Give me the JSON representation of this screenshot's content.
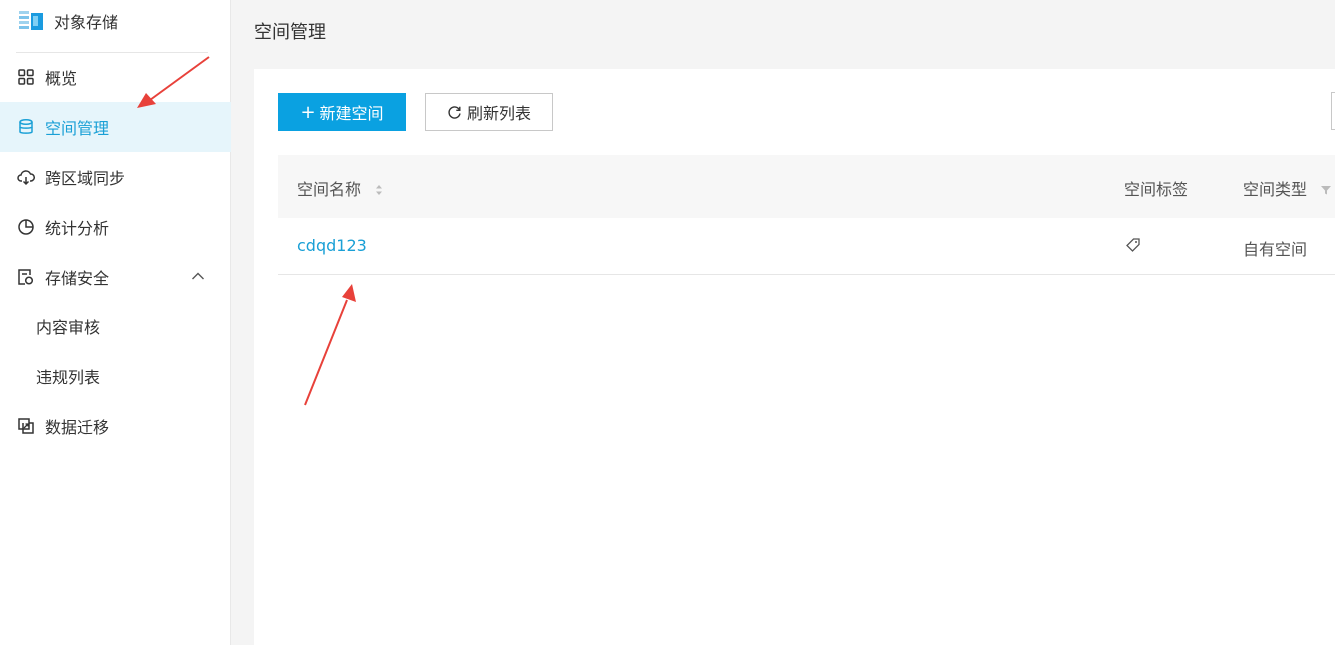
{
  "sidebar": {
    "brand_title": "对象存储",
    "items": [
      {
        "label": "概览",
        "icon": "grid-icon"
      },
      {
        "label": "空间管理",
        "icon": "database-icon",
        "active": true
      },
      {
        "label": "跨区域同步",
        "icon": "cloud-sync-icon"
      },
      {
        "label": "统计分析",
        "icon": "pie-chart-icon"
      },
      {
        "label": "存储安全",
        "icon": "shield-doc-icon",
        "expanded": true
      },
      {
        "label": "内容审核"
      },
      {
        "label": "违规列表"
      },
      {
        "label": "数据迁移",
        "icon": "migrate-icon"
      }
    ]
  },
  "header": {
    "title": "空间管理"
  },
  "toolbar": {
    "new_label": "新建空间",
    "refresh_label": "刷新列表"
  },
  "table": {
    "columns": [
      "空间名称",
      "空间标签",
      "空间类型"
    ],
    "rows": [
      {
        "name": "cdqd123",
        "type": "自有空间"
      }
    ]
  },
  "colors": {
    "accent": "#0aa1e1",
    "link": "#1aa0d6",
    "active_bg": "#e6f5fb",
    "annotation_arrow": "#e8413a"
  }
}
